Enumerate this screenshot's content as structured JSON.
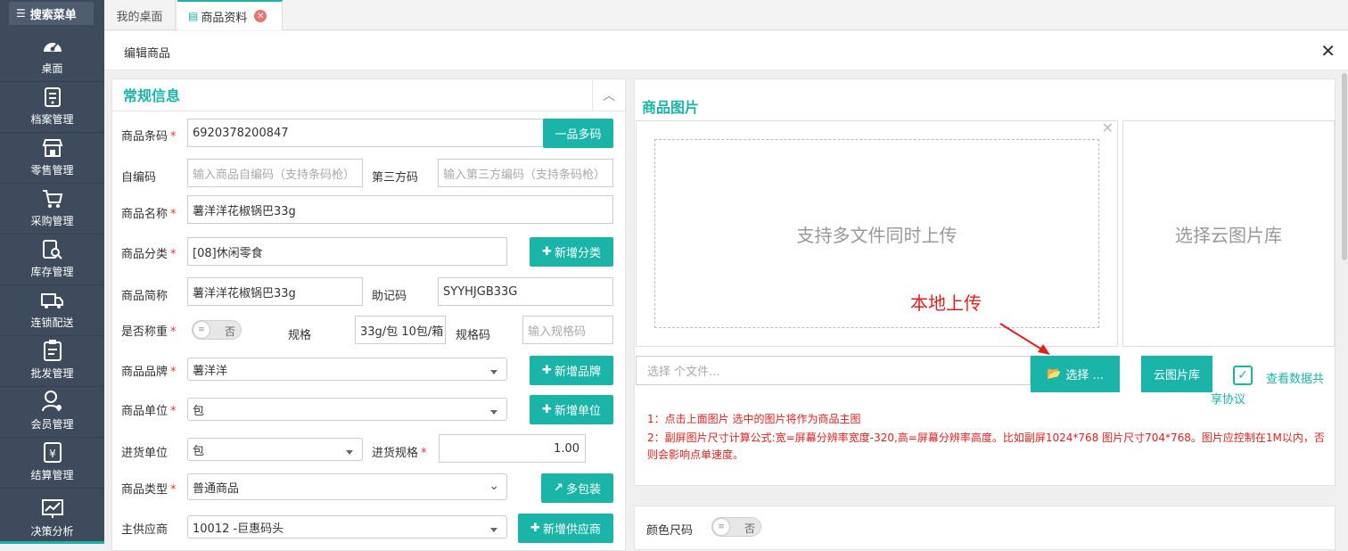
{
  "sidebar": {
    "search_label": "搜索菜单",
    "items": [
      {
        "label": "桌面",
        "icon": "dashboard-icon"
      },
      {
        "label": "档案管理",
        "icon": "archive-icon"
      },
      {
        "label": "零售管理",
        "icon": "store-icon"
      },
      {
        "label": "采购管理",
        "icon": "cart-icon"
      },
      {
        "label": "库存管理",
        "icon": "inventory-search-icon"
      },
      {
        "label": "连锁配送",
        "icon": "truck-icon"
      },
      {
        "label": "批发管理",
        "icon": "clipboard-icon"
      },
      {
        "label": "会员管理",
        "icon": "member-icon"
      },
      {
        "label": "结算管理",
        "icon": "yen-icon"
      },
      {
        "label": "决策分析",
        "icon": "chart-icon"
      }
    ]
  },
  "tabs": {
    "home": "我的桌面",
    "product": "商品资料"
  },
  "edit_header": {
    "title": "编辑商品"
  },
  "general": {
    "title": "常规信息",
    "barcode_label": "商品条码",
    "barcode_value": "6920378200847",
    "multi_code_btn": "一品多码",
    "self_code_label": "自编码",
    "self_code_placeholder": "输入商品自编码（支持条码枪）",
    "third_code_label": "第三方码",
    "third_code_placeholder": "输入第三方编码（支持条码枪）",
    "name_label": "商品名称",
    "name_value": "薯洋洋花椒锅巴33g",
    "category_label": "商品分类",
    "category_value": "[08]休闲零食",
    "add_category_btn": "新增分类",
    "short_name_label": "商品简称",
    "short_name_value": "薯洋洋花椒锅巴33g",
    "mnemonic_label": "助记码",
    "mnemonic_value": "SYYHJGB33G",
    "weigh_label": "是否称重",
    "weigh_toggle": "否",
    "spec_label": "规格",
    "spec_value": "33g/包 10包/箱",
    "spec_code_label": "规格码",
    "spec_code_placeholder": "输入规格码",
    "brand_label": "商品品牌",
    "brand_value": "薯洋洋",
    "add_brand_btn": "新增品牌",
    "unit_label": "商品单位",
    "unit_value": "包",
    "add_unit_btn": "新增单位",
    "purchase_unit_label": "进货单位",
    "purchase_unit_value": "包",
    "purchase_spec_label": "进货规格",
    "purchase_spec_value": "1.00",
    "type_label": "商品类型",
    "type_value": "普通商品",
    "multi_pack_btn": "多包装",
    "supplier_label": "主供应商",
    "supplier_value": "10012 -巨惠码头",
    "add_supplier_btn": "新增供应商"
  },
  "images": {
    "title": "商品图片",
    "upload_hint": "支持多文件同时上传",
    "cloud_hint": "选择云图片库",
    "local_upload_annotation": "本地上传",
    "file_placeholder": "选择 个文件...",
    "choose_btn": "选择 ...",
    "cloud_btn": "云图片库",
    "share_link_line1": "查看数据共",
    "share_link_line2": "享协议",
    "note1": "1：点击上面图片 选中的图片将作为商品主图",
    "note2": "2：副屏图片尺寸计算公式:宽=屏幕分辨率宽度-320,高=屏幕分辨率高度。比如副屏1024*768 图片尺寸704*768。图片应控制在1M以内，否则会影响点单速度。"
  },
  "color_size": {
    "label": "颜色尺码",
    "toggle": "否"
  },
  "colors": {
    "accent": "#1bb4a8",
    "sidebar_bg": "#3d4b5c",
    "required": "#e33333",
    "annotation": "#e02020"
  }
}
